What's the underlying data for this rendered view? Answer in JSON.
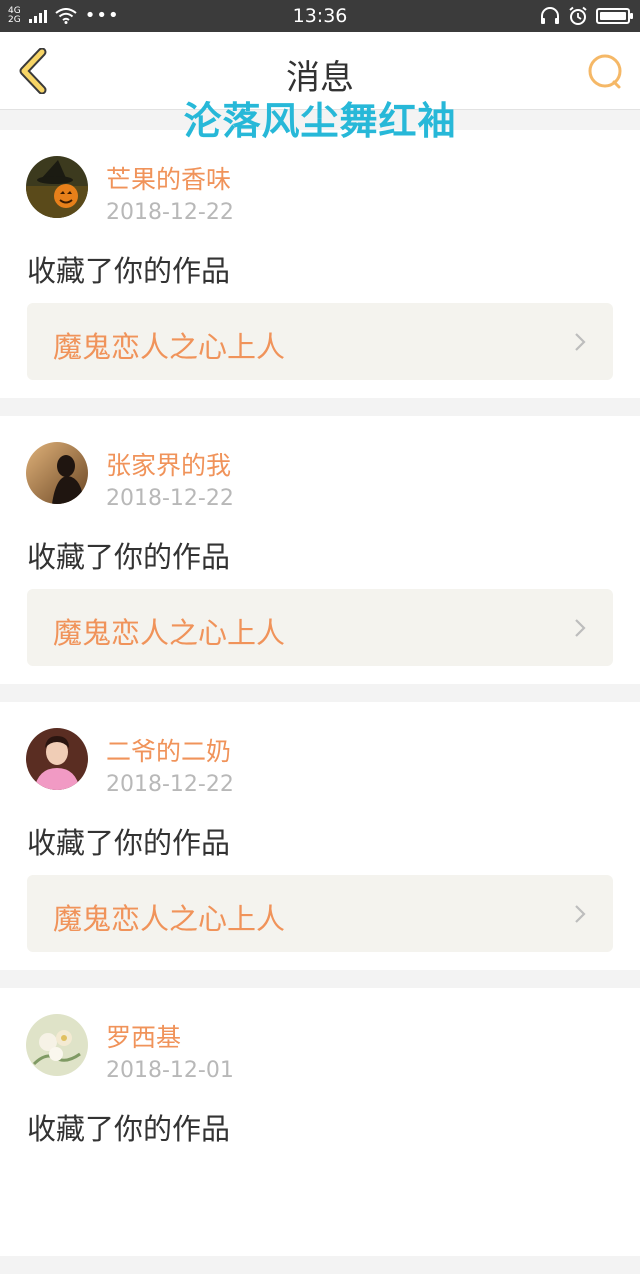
{
  "status_bar": {
    "network_top": "4G",
    "network_bottom": "2G",
    "dots": "•••",
    "time": "13:36",
    "battery_level": 1.0
  },
  "header": {
    "title": "消息",
    "watermark": "沦落风尘舞红袖",
    "accent_color": "#f5b867"
  },
  "messages": [
    {
      "user": "芒果的香味",
      "date": "2018-12-22",
      "action": "收藏了你的作品",
      "work": "魔鬼恋人之心上人",
      "avatar": "pumpkin-witch-avatar"
    },
    {
      "user": "张家界的我",
      "date": "2018-12-22",
      "action": "收藏了你的作品",
      "work": "魔鬼恋人之心上人",
      "avatar": "sunset-silhouette-avatar"
    },
    {
      "user": "二爷的二奶",
      "date": "2018-12-22",
      "action": "收藏了你的作品",
      "work": "魔鬼恋人之心上人",
      "avatar": "person-pink-shirt-avatar"
    },
    {
      "user": "罗西基",
      "date": "2018-12-01",
      "action": "收藏了你的作品",
      "work": "",
      "avatar": "flower-painting-avatar"
    }
  ],
  "colors": {
    "username": "#f0935a",
    "watermark": "#27b8d8",
    "status_bar_bg": "#3b3b3b"
  }
}
